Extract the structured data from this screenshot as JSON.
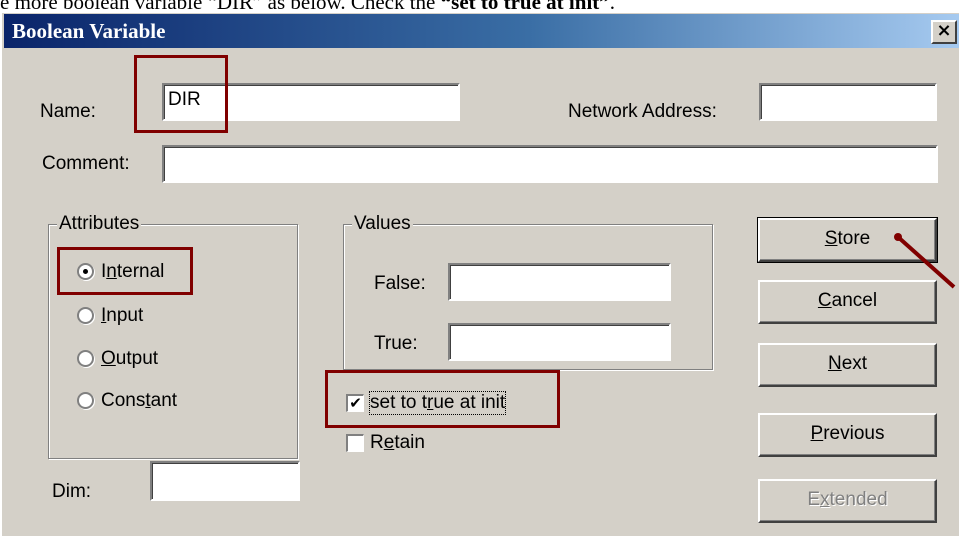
{
  "document_text": {
    "prefix": "e more boolean variable “DIR” as below. Check the ",
    "emphasis": "“set to true at init”",
    "suffix": "."
  },
  "dialog": {
    "title": "Boolean Variable",
    "close_glyph": "×"
  },
  "fields": {
    "name_label": "Name:",
    "name_value": "DIR",
    "network_address_label": "Network Address:",
    "network_address_value": "",
    "comment_label": "Comment:",
    "comment_value": "",
    "dim_label": "Dim:",
    "dim_value": ""
  },
  "attributes": {
    "title": "Attributes",
    "options": [
      {
        "label": "Internal",
        "checked": true
      },
      {
        "label": "Input",
        "checked": false
      },
      {
        "label": "Output",
        "checked": false
      },
      {
        "label": "Constant",
        "checked": false
      }
    ]
  },
  "values": {
    "title": "Values",
    "false_label": "False:",
    "false_value": "",
    "true_label": "True:",
    "true_value": ""
  },
  "checkboxes": {
    "set_true_at_init": {
      "label": "set to true at init",
      "checked": true
    },
    "retain": {
      "label": "Retain",
      "checked": false
    }
  },
  "buttons": {
    "store": "Store",
    "cancel": "Cancel",
    "next": "Next",
    "previous": "Previous",
    "extended": "Extended"
  },
  "colors": {
    "highlight": "#800000",
    "face": "#d4d0c8",
    "title_start": "#0a246a",
    "title_end": "#a6caf0"
  }
}
